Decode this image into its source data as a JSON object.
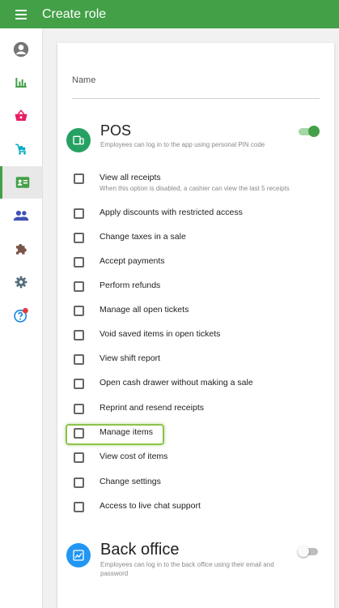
{
  "header": {
    "title": "Create role"
  },
  "sidebar": {
    "items": [
      {
        "name": "account-icon"
      },
      {
        "name": "reports-icon",
        "color": "#43a047"
      },
      {
        "name": "basket-icon",
        "color": "#e91e63"
      },
      {
        "name": "inventory-icon",
        "color": "#00acc1"
      },
      {
        "name": "employee-card-icon",
        "color": "#43a047",
        "active": true
      },
      {
        "name": "customers-icon",
        "color": "#3f51b5"
      },
      {
        "name": "integrations-icon",
        "color": "#795548"
      },
      {
        "name": "settings-icon",
        "color": "#607d8b"
      },
      {
        "name": "help-icon",
        "color": "#1e88e5"
      }
    ]
  },
  "form": {
    "name_label": "Name"
  },
  "pos": {
    "title": "POS",
    "description": "Employees can log in to the app using personal PIN code",
    "enabled": true,
    "icon_color": "#26a163"
  },
  "permissions": [
    {
      "label": "View all receipts",
      "sub": "When this option is disabled, a cashier can view the last 5 receipts"
    },
    {
      "label": "Apply discounts with restricted access"
    },
    {
      "label": "Change taxes in a sale"
    },
    {
      "label": "Accept payments"
    },
    {
      "label": "Perform refunds"
    },
    {
      "label": "Manage all open tickets"
    },
    {
      "label": "Void saved items in open tickets"
    },
    {
      "label": "View shift report"
    },
    {
      "label": "Open cash drawer without making a sale"
    },
    {
      "label": "Reprint and resend receipts"
    },
    {
      "label": "Manage items"
    },
    {
      "label": "View cost of items"
    },
    {
      "label": "Change settings"
    },
    {
      "label": "Access to live chat support"
    }
  ],
  "back_office": {
    "title": "Back office",
    "description": "Employees can log in to the back office using their email and password",
    "enabled": false,
    "icon_color": "#2196f3"
  }
}
